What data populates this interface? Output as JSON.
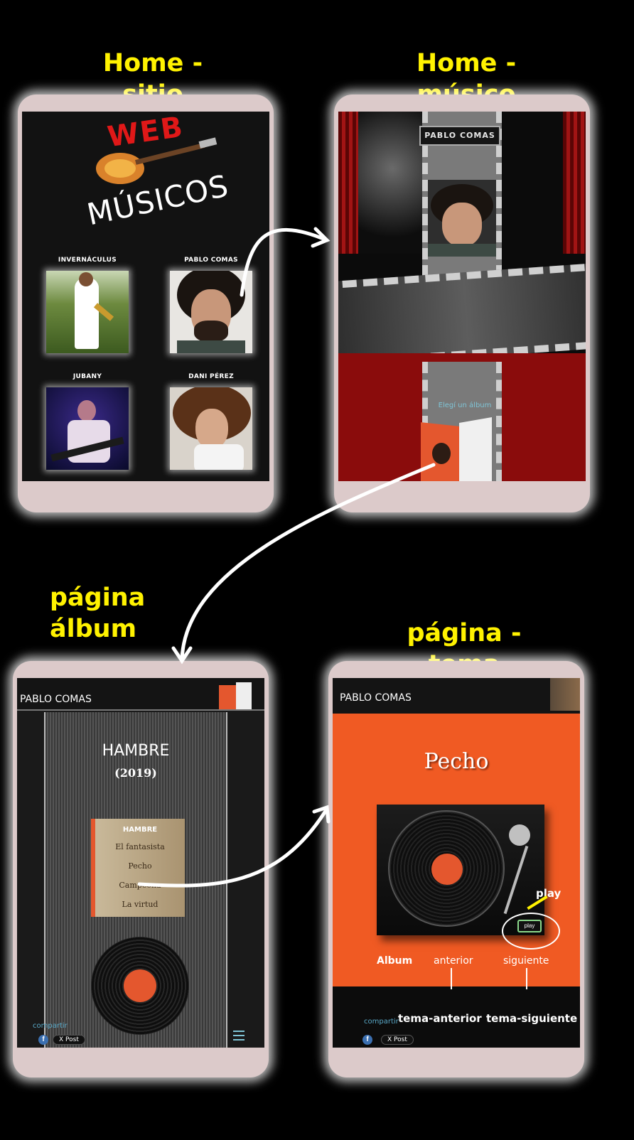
{
  "headings": {
    "home_sitio": "Home - sitio",
    "home_musico": "Home - músico",
    "pagina_album": "página\nálbum",
    "pagina_tema": "página - tema"
  },
  "site": {
    "logo_web": "WEB",
    "logo_musicos": "MÚSICOS",
    "musicians": [
      {
        "name": "INVERNÁCULUS"
      },
      {
        "name": "PABLO COMAS"
      },
      {
        "name": "JUBANY"
      },
      {
        "name": "DANI PÉREZ"
      }
    ]
  },
  "musician_home": {
    "name_sign": "PABLO COMAS",
    "choose_album": "Elegí un álbum"
  },
  "album_page": {
    "artist": "PABLO COMAS",
    "album_title": "HAMBRE",
    "year": "(2019)",
    "tracklist_title": "HAMBRE",
    "tracks": [
      "El fantasista",
      "Pecho",
      "Campeona",
      "La virtud"
    ],
    "share_label": "compartir",
    "x_post": "X Post"
  },
  "song_page": {
    "artist": "PABLO COMAS",
    "song_title": "Pecho",
    "play_button": "play",
    "play_annotation": "play",
    "nav": {
      "album": "Album",
      "prev": "anterior",
      "next": "siguiente"
    },
    "annot_prev": "tema-anterior",
    "annot_next": "tema-siguiente",
    "share_label": "compartir",
    "x_post": "X Post"
  },
  "colors": {
    "heading": "#fff200",
    "phone_frame": "#dccaca",
    "song_bg": "#f05a23",
    "curtain": "#8a0c0c"
  }
}
